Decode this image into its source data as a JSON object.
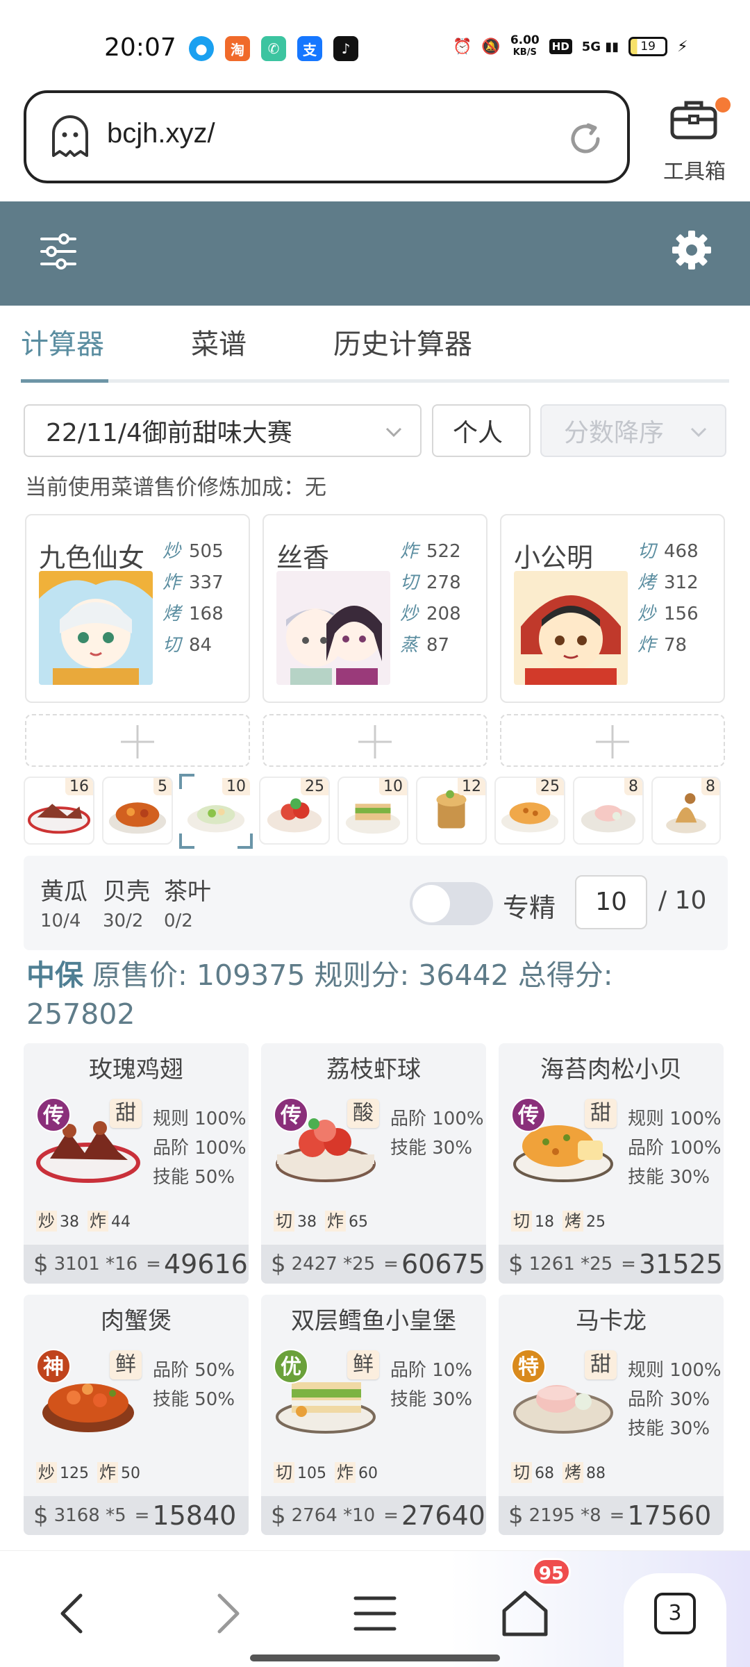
{
  "status": {
    "time": "20:07",
    "net_speed_top": "6.00",
    "net_speed_unit": "KB/S",
    "hd": "HD",
    "net": "5G",
    "battery": "19"
  },
  "browser": {
    "url": "bcjh.xyz/",
    "toolbox_label": "工具箱"
  },
  "tabs": [
    {
      "label": "计算器"
    },
    {
      "label": "菜谱"
    },
    {
      "label": "历史计算器"
    }
  ],
  "filters": {
    "contest": "22/11/4御前甜味大赛",
    "mode": "个人",
    "sort": "分数降序"
  },
  "bonus_text": "当前使用菜谱售价修炼加成：无",
  "chefs": [
    {
      "name": "九色仙女",
      "skills": [
        {
          "k": "炒",
          "v": "505"
        },
        {
          "k": "炸",
          "v": "337"
        },
        {
          "k": "烤",
          "v": "168"
        },
        {
          "k": "切",
          "v": "84"
        }
      ]
    },
    {
      "name": "丝香",
      "skills": [
        {
          "k": "炸",
          "v": "522"
        },
        {
          "k": "切",
          "v": "278"
        },
        {
          "k": "炒",
          "v": "208"
        },
        {
          "k": "蒸",
          "v": "87"
        }
      ]
    },
    {
      "name": "小公明",
      "skills": [
        {
          "k": "切",
          "v": "468"
        },
        {
          "k": "烤",
          "v": "312"
        },
        {
          "k": "炒",
          "v": "156"
        },
        {
          "k": "炸",
          "v": "78"
        }
      ]
    }
  ],
  "thumbs": [
    {
      "count": "16"
    },
    {
      "count": "5"
    },
    {
      "count": "10"
    },
    {
      "count": "25"
    },
    {
      "count": "10"
    },
    {
      "count": "12"
    },
    {
      "count": "25"
    },
    {
      "count": "8"
    },
    {
      "count": "8"
    }
  ],
  "ingredients": [
    {
      "name": "黄瓜",
      "value": "10/4"
    },
    {
      "name": "贝壳",
      "value": "30/2"
    },
    {
      "name": "茶叶",
      "value": "0/2"
    }
  ],
  "spec": {
    "label": "专精",
    "value": "10",
    "max": "/ 10"
  },
  "score": {
    "grade": "中保",
    "text": "原售价: 109375 规则分: 36442 总得分: 257802"
  },
  "recipes": [
    {
      "title": "玫瑰鸡翅",
      "rarity": "传",
      "flavor": "甜",
      "stats": [
        "规则 100%",
        "品阶 100%",
        "技能 50%"
      ],
      "skills": [
        {
          "t": "炒",
          "v": "38"
        },
        {
          "t": "炸",
          "v": "44"
        }
      ],
      "price": "3101 *16",
      "total": "49616"
    },
    {
      "title": "荔枝虾球",
      "rarity": "传",
      "flavor": "酸",
      "stats": [
        "品阶 100%",
        "技能 30%"
      ],
      "skills": [
        {
          "t": "切",
          "v": "38"
        },
        {
          "t": "炸",
          "v": "65"
        }
      ],
      "price": "2427 *25",
      "total": "60675"
    },
    {
      "title": "海苔肉松小贝",
      "rarity": "传",
      "flavor": "甜",
      "stats": [
        "规则 100%",
        "品阶 100%",
        "技能 30%"
      ],
      "skills": [
        {
          "t": "切",
          "v": "18"
        },
        {
          "t": "烤",
          "v": "25"
        }
      ],
      "price": "1261 *25",
      "total": "31525"
    },
    {
      "title": "肉蟹煲",
      "rarity": "神",
      "flavor": "鲜",
      "stats": [
        "品阶 50%",
        "技能 50%"
      ],
      "skills": [
        {
          "t": "炒",
          "v": "125"
        },
        {
          "t": "炸",
          "v": "50"
        }
      ],
      "price": "3168 *5",
      "total": "15840"
    },
    {
      "title": "双层鳕鱼小皇堡",
      "rarity": "优",
      "flavor": "鲜",
      "stats": [
        "品阶 10%",
        "技能 30%"
      ],
      "skills": [
        {
          "t": "切",
          "v": "105"
        },
        {
          "t": "炸",
          "v": "60"
        }
      ],
      "price": "2764 *10",
      "total": "27640"
    },
    {
      "title": "马卡龙",
      "rarity": "特",
      "flavor": "甜",
      "stats": [
        "规则 100%",
        "品阶 30%",
        "技能 30%"
      ],
      "skills": [
        {
          "t": "切",
          "v": "68"
        },
        {
          "t": "烤",
          "v": "88"
        }
      ],
      "price": "2195 *8",
      "total": "17560"
    }
  ],
  "bottom_nav": {
    "home_badge": "95",
    "tab_count": "3"
  },
  "colors": {
    "header": "#5f7c89",
    "accent": "#5a8da0",
    "rarity_legend": "#8a2f7a",
    "rarity_god": "#c0441d",
    "rarity_good": "#6aa13a",
    "rarity_special": "#d98a1c"
  }
}
